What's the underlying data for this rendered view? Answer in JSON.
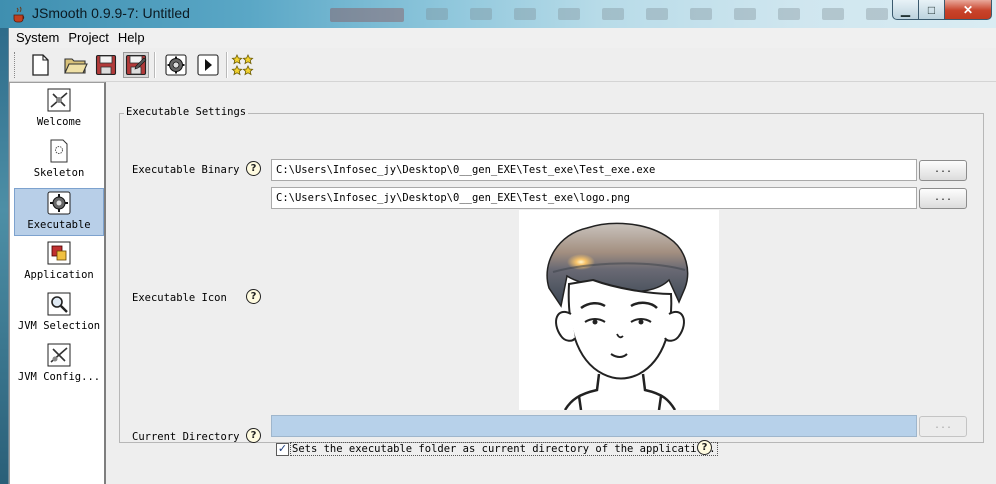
{
  "window": {
    "title": "JSmooth 0.9.9-7: Untitled",
    "controls": {
      "minimize": "▁",
      "maximize": "□",
      "close": "✕"
    }
  },
  "menu": [
    "System",
    "Project",
    "Help"
  ],
  "toolbar": {
    "buttons": [
      "new-icon",
      "open-folder-icon",
      "save-icon",
      "save-as-icon",
      "compile-gear-icon",
      "run-play-icon",
      "about-stars-icon"
    ]
  },
  "sidebar": {
    "items": [
      {
        "label": "Welcome",
        "icon": "welcome-icon"
      },
      {
        "label": "Skeleton",
        "icon": "skeleton-icon"
      },
      {
        "label": "Executable",
        "icon": "executable-icon",
        "selected": true
      },
      {
        "label": "Application",
        "icon": "application-icon"
      },
      {
        "label": "JVM Selection",
        "icon": "jvm-selection-icon"
      },
      {
        "label": "JVM Config...",
        "icon": "jvm-config-icon"
      }
    ]
  },
  "executable": {
    "group_title": "Executable Settings",
    "binary_label": "Executable Binary",
    "binary_value": "C:\\Users\\Infosec_jy\\Desktop\\0__gen_EXE\\Test_exe\\Test_exe.exe",
    "icon_label": "Executable Icon",
    "icon_value": "C:\\Users\\Infosec_jy\\Desktop\\0__gen_EXE\\Test_exe\\logo.png",
    "curdir_label": "Current Directory",
    "curdir_value": "",
    "browse_label": "...",
    "checkbox_label": "Sets the executable folder as current directory of the application.",
    "checkbox_checked": true,
    "help_glyph": "?"
  }
}
